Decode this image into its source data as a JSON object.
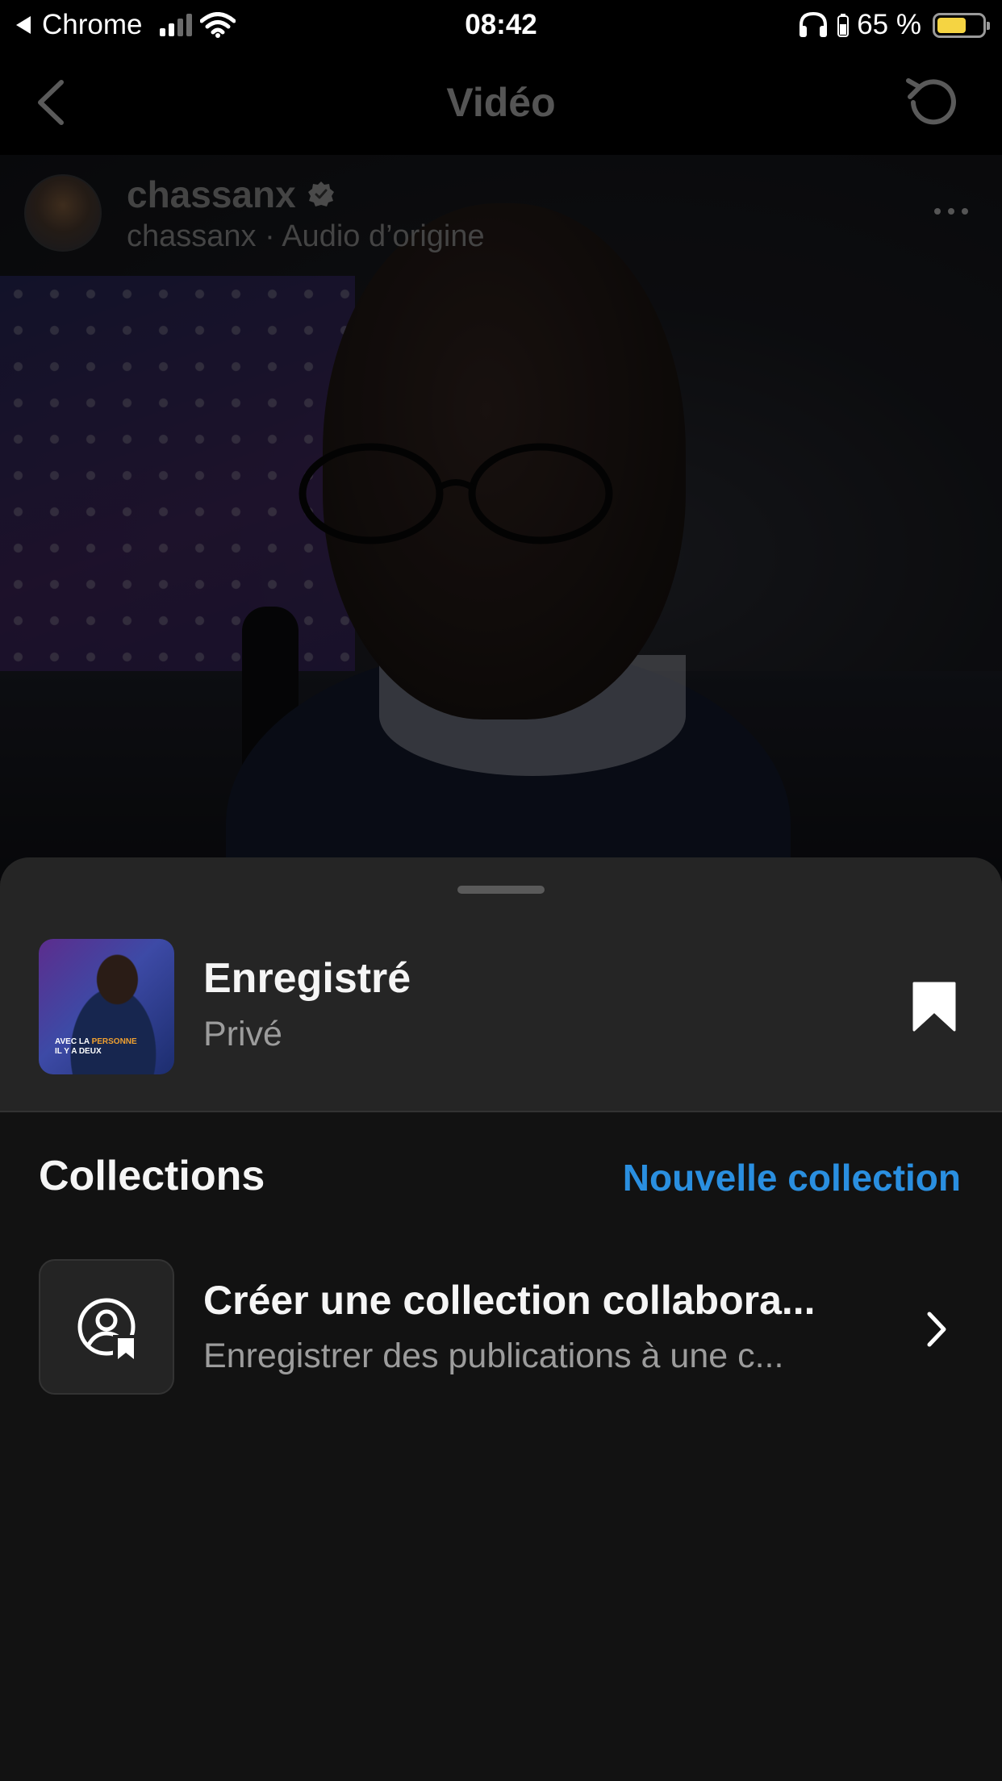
{
  "status_bar": {
    "back_app": "Chrome",
    "time": "08:42",
    "battery_percent": "65 %",
    "battery_level": 0.65,
    "signal_bars_active": 2,
    "signal_bars_total": 4
  },
  "nav": {
    "title": "Vidéo",
    "back_icon": "chevron-left-icon",
    "refresh_icon": "refresh-icon"
  },
  "post": {
    "username": "chassanx",
    "verified": true,
    "subtitle": "chassanx · Audio d’origine"
  },
  "sheet": {
    "saved_title": "Enregistré",
    "saved_subtitle": "Privé",
    "thumb_caption_line1_a": "AVEC LA ",
    "thumb_caption_line1_b": "PERSONNE",
    "thumb_caption_line2": "IL Y A DEUX",
    "bookmark_icon": "bookmark-filled-icon",
    "collections_title": "Collections",
    "new_collection_label": "Nouvelle collection",
    "collab_title": "Créer une collection collabora...",
    "collab_subtitle": "Enregistrer des publications à une c..."
  },
  "colors": {
    "accent_link": "#2a8fe0",
    "sheet_top_bg": "#252525",
    "page_bg": "#121212",
    "battery_fill": "#f5d442"
  }
}
